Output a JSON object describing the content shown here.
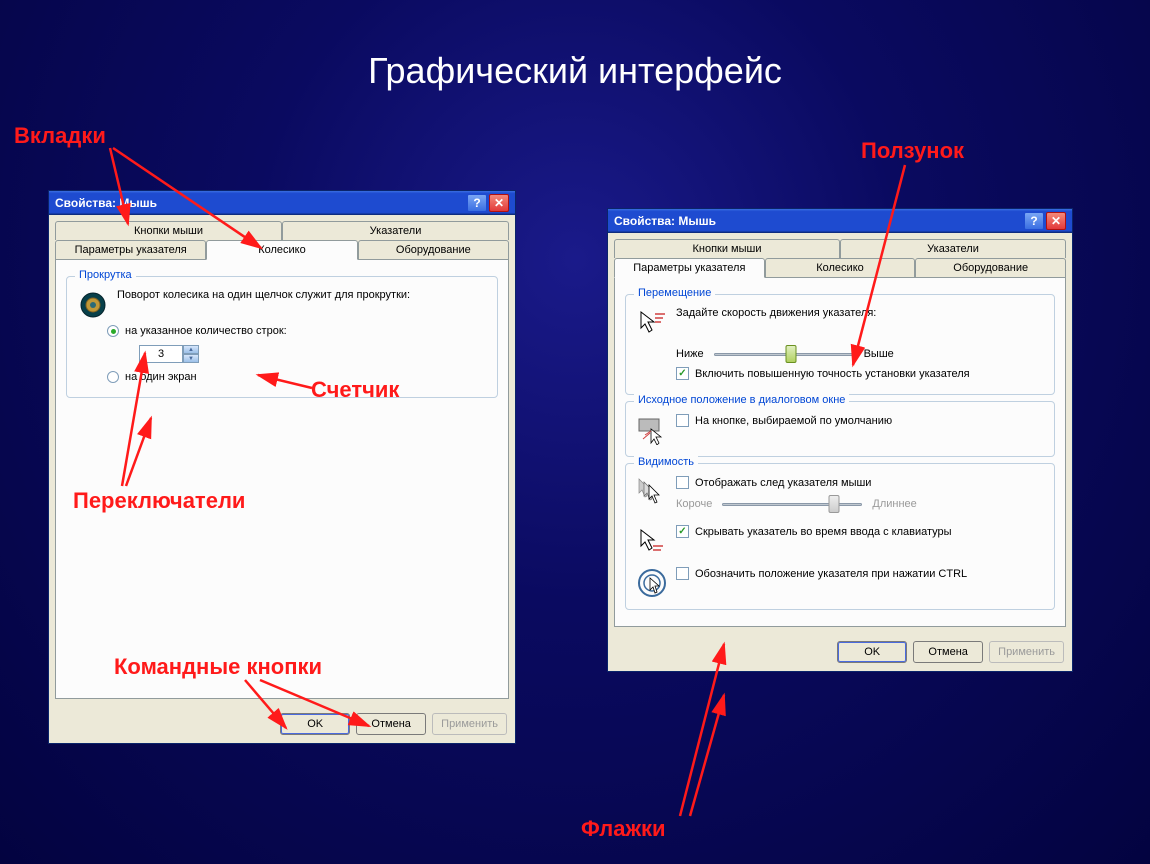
{
  "slide": {
    "title": "Графический интерфейс"
  },
  "annotations": {
    "tabs": "Вкладки",
    "slider": "Ползунок",
    "spinner": "Счетчик",
    "radios": "Переключатели",
    "buttons": "Командные кнопки",
    "checkboxes": "Флажки"
  },
  "dialog1": {
    "title": "Свойства: Мышь",
    "tabs_top": {
      "a": "Кнопки мыши",
      "b": "Указатели"
    },
    "tabs_bot": {
      "a": "Параметры указателя",
      "b": "Колесико",
      "c": "Оборудование"
    },
    "group_scroll": {
      "title": "Прокрутка",
      "text": "Поворот колесика на один щелчок служит для прокрутки:",
      "radio1": "на указанное количество строк:",
      "spinner_value": "3",
      "radio2": "на один экран"
    },
    "buttons": {
      "ok": "OK",
      "cancel": "Отмена",
      "apply": "Применить"
    }
  },
  "dialog2": {
    "title": "Свойства: Мышь",
    "tabs_top": {
      "a": "Кнопки мыши",
      "b": "Указатели"
    },
    "tabs_bot": {
      "a": "Параметры указателя",
      "b": "Колесико",
      "c": "Оборудование"
    },
    "group_move": {
      "title": "Перемещение",
      "text": "Задайте скорость движения указателя:",
      "low": "Ниже",
      "high": "Выше",
      "check1": "Включить повышенную точность установки указателя"
    },
    "group_home": {
      "title": "Исходное положение в диалоговом окне",
      "check1": "На кнопке, выбираемой по умолчанию"
    },
    "group_visibility": {
      "title": "Видимость",
      "check1": "Отображать след указателя мыши",
      "short": "Короче",
      "long": "Длиннее",
      "check2": "Скрывать указатель во время ввода с клавиатуры",
      "check3": "Обозначить положение указателя при нажатии CTRL"
    },
    "buttons": {
      "ok": "OK",
      "cancel": "Отмена",
      "apply": "Применить"
    }
  }
}
